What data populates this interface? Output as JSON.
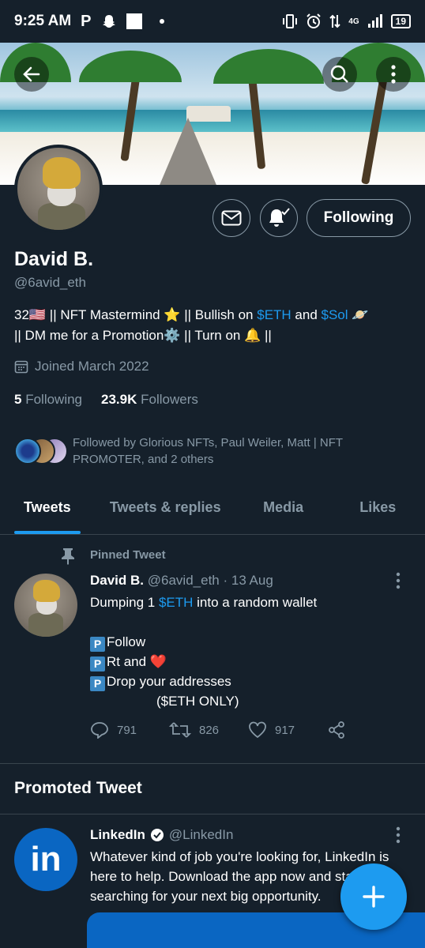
{
  "status_bar": {
    "time": "9:25 AM",
    "network": "4G",
    "battery": "19"
  },
  "profile": {
    "display_name": "David B.",
    "handle": "@6avid_eth",
    "bio_line1_pre": "32🇺🇸 || NFT Mastermind ⭐ || Bullish on ",
    "bio_link1": "$ETH",
    "bio_and": " and ",
    "bio_link2": "$Sol",
    "bio_line1_post": " 🪐",
    "bio_line2": "|| DM me for a Promotion⚙️ || Turn on 🔔 ||",
    "joined": "Joined March 2022",
    "following_count": "5",
    "following_label": "Following",
    "followers_count": "23.9K",
    "followers_label": "Followers",
    "followed_by": "Followed by Glorious NFTs, Paul Weiler, Matt | NFT PROMOTER, and 2 others",
    "following_button": "Following"
  },
  "tabs": [
    {
      "label": "Tweets",
      "active": true
    },
    {
      "label": "Tweets & replies",
      "active": false
    },
    {
      "label": "Media",
      "active": false
    },
    {
      "label": "Likes",
      "active": false
    }
  ],
  "pinned_tweet": {
    "pinned_label": "Pinned Tweet",
    "name": "David B.",
    "meta": "@6avid_eth · 13 Aug",
    "line1_pre": "Dumping 1 ",
    "line1_link": "$ETH",
    "line1_post": " into a random wallet",
    "line2": "Follow",
    "line3": "Rt and ❤️",
    "line4": "Drop your addresses",
    "line5": "($ETH ONLY)",
    "p_glyph": "P",
    "replies": "791",
    "retweets": "826",
    "likes": "917"
  },
  "promoted": {
    "section_title": "Promoted Tweet",
    "name": "LinkedIn",
    "handle": "@LinkedIn",
    "avatar_text": "in",
    "body": "Whatever kind of job you're looking for, LinkedIn is here to help. Download the app now and start searching for your next big opportunity."
  },
  "colors": {
    "background": "#15202b",
    "accent": "#1d9bf0",
    "muted": "#8899a6",
    "linkedin": "#0a66c2"
  }
}
